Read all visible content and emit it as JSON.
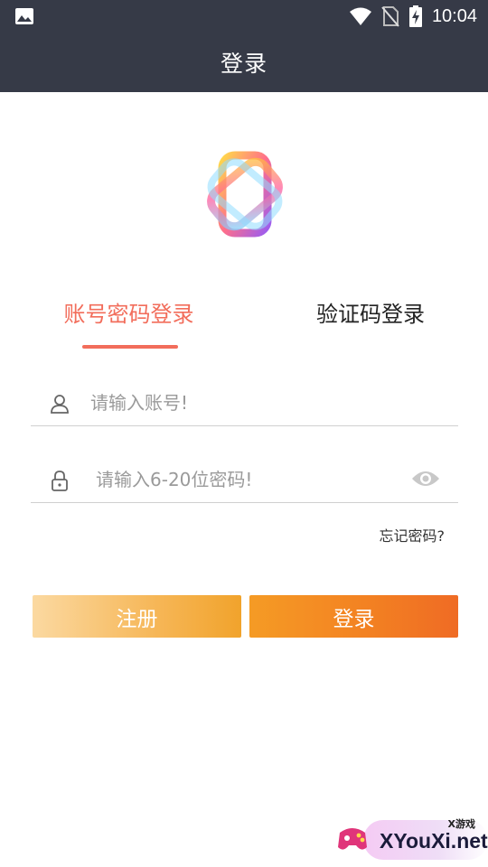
{
  "status_bar": {
    "time": "10:04"
  },
  "header": {
    "title": "登录"
  },
  "tabs": [
    {
      "label": "账号密码登录",
      "active": true
    },
    {
      "label": "验证码登录",
      "active": false
    }
  ],
  "form": {
    "account_placeholder": "请输入账号!",
    "password_placeholder": "请输入6-20位密码!",
    "account_value": "",
    "password_value": "",
    "forgot_label": "忘记密码?"
  },
  "buttons": {
    "register_label": "注册",
    "login_label": "登录"
  },
  "watermark": {
    "small": "X游戏",
    "text": "XYouXi.net"
  },
  "colors": {
    "header_bg": "#363a47",
    "accent": "#f26d5b",
    "login_button": "#f38222",
    "register_button": "#f6b656"
  },
  "icons": [
    "image-icon",
    "wifi-icon",
    "no-sim-icon",
    "battery-charging-icon",
    "app-logo",
    "user-icon",
    "lock-icon",
    "eye-icon",
    "gamepad-icon"
  ]
}
